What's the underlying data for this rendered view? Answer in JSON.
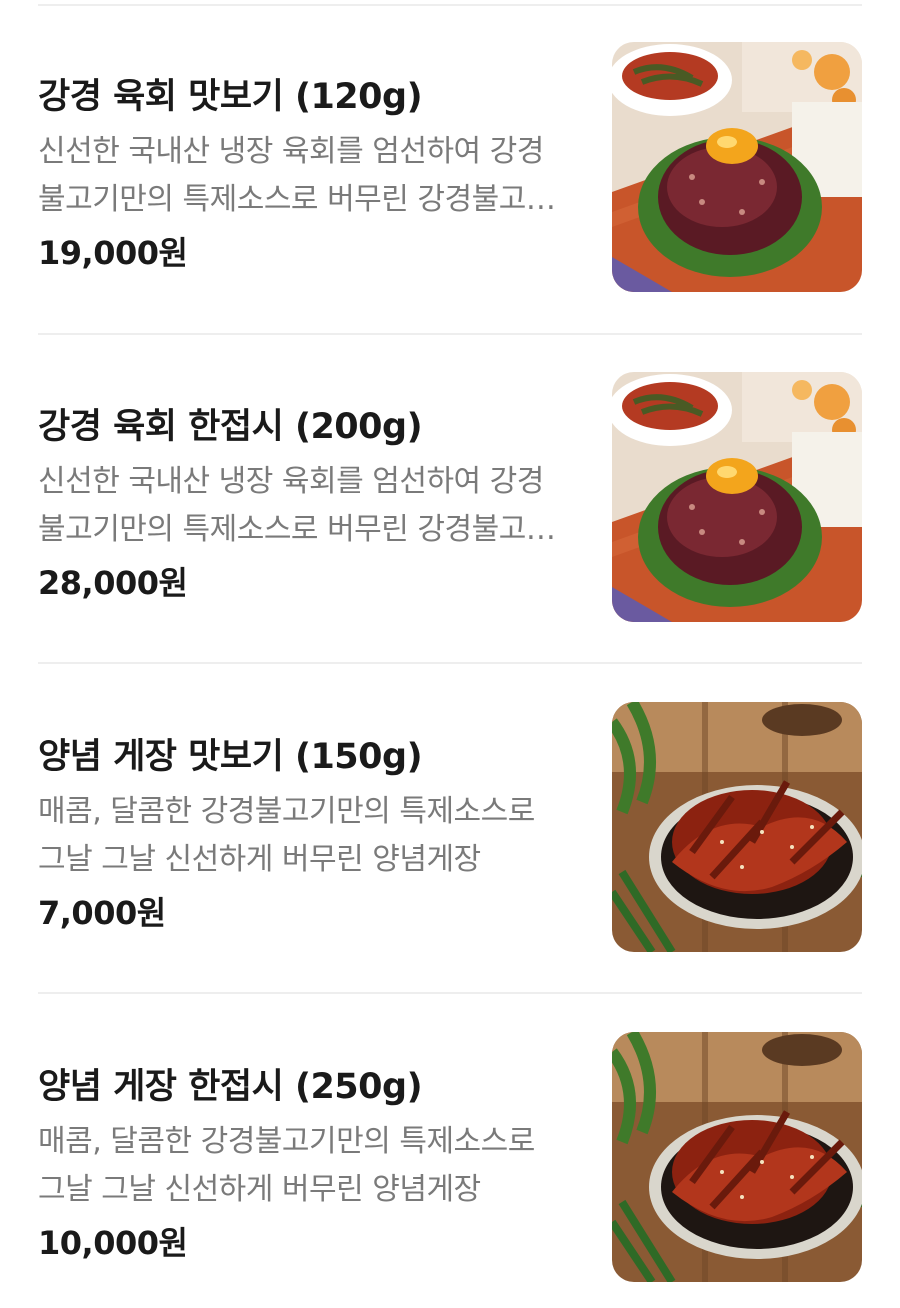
{
  "menu": {
    "items": [
      {
        "name": "강경 육회 맛보기 (120g)",
        "description": "신선한 국내산 냉장 육회를 엄선하여 강경불고기만의 특제소스로 버무린 강경불고기만의 육회",
        "price": "19,000원",
        "image": "beef-tartare-photo"
      },
      {
        "name": "강경 육회 한접시 (200g)",
        "description": "신선한 국내산 냉장 육회를 엄선하여 강경불고기만의 특제소스로 버무린 강경불고기만의 육회",
        "price": "28,000원",
        "image": "beef-tartare-photo"
      },
      {
        "name": "양념 게장 맛보기 (150g)",
        "description": "매콤, 달콤한 강경불고기만의 특제소스로 그날 그날 신선하게 버무린 양념게장",
        "price": "7,000원",
        "image": "spicy-crab-photo"
      },
      {
        "name": "양념 게장 한접시 (250g)",
        "description": "매콤, 달콤한 강경불고기만의 특제소스로 그날 그날 신선하게 버무린 양념게장",
        "price": "10,000원",
        "image": "spicy-crab-photo"
      }
    ]
  }
}
